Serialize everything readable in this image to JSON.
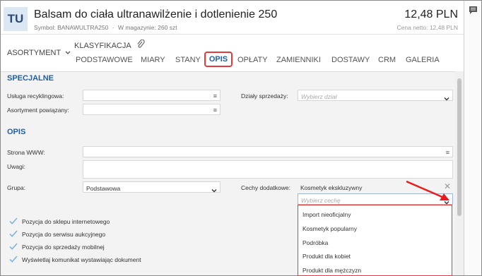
{
  "header": {
    "avatar": "TU",
    "title": "Balsam do ciała ultranawilżenie i dotlenienie 250",
    "symbol": "Symbol: BANAWULTRA250",
    "separator": "·",
    "stock": "W magazynie: 260 szt",
    "price": "12,48 PLN",
    "net_price": "Cena netto: 12,48 PLN"
  },
  "nav": {
    "asortyment": "ASORTYMENT",
    "klasyfikacja": "KLASYFIKACJA",
    "tabs": [
      "PODSTAWOWE",
      "MIARY",
      "STANY",
      "OPIS",
      "OPŁATY",
      "ZAMIENNIKI",
      "DOSTAWY",
      "CRM",
      "GALERIA"
    ],
    "active_tab": "OPIS"
  },
  "specjalne": {
    "heading": "SPECJALNE",
    "recycling_label": "Usługa recyklingowa:",
    "related_label": "Asortyment powiązany:",
    "sales_dept_label": "Działy sprzedaży:",
    "sales_dept_placeholder": "Wybierz dział"
  },
  "opis": {
    "heading": "OPIS",
    "www_label": "Strona WWW:",
    "notes_label": "Uwagi:",
    "group_label": "Grupa:",
    "group_value": "Podstawowa",
    "features_label": "Cechy dodatkowe:",
    "features_selected": "Kosmetyk ekskluzywny",
    "features_placeholder": "Wybierz cechę"
  },
  "checkboxes": [
    "Pozycja do sklepu internetowego",
    "Pozycja do serwisu aukcyjnego",
    "Pozycja do sprzedaży mobilnej",
    "Wyświetlaj komunikat wystawiając dokument"
  ],
  "dropdown_options": [
    "Import nieoficjalny",
    "Kosmetyk popularny",
    "Podróbka",
    "Produkt dla kobiet",
    "Produkt dla mężczyzn"
  ],
  "colors": {
    "accent": "#1f5fa8",
    "highlight": "#e33b3b",
    "check": "#7fb3e0"
  }
}
